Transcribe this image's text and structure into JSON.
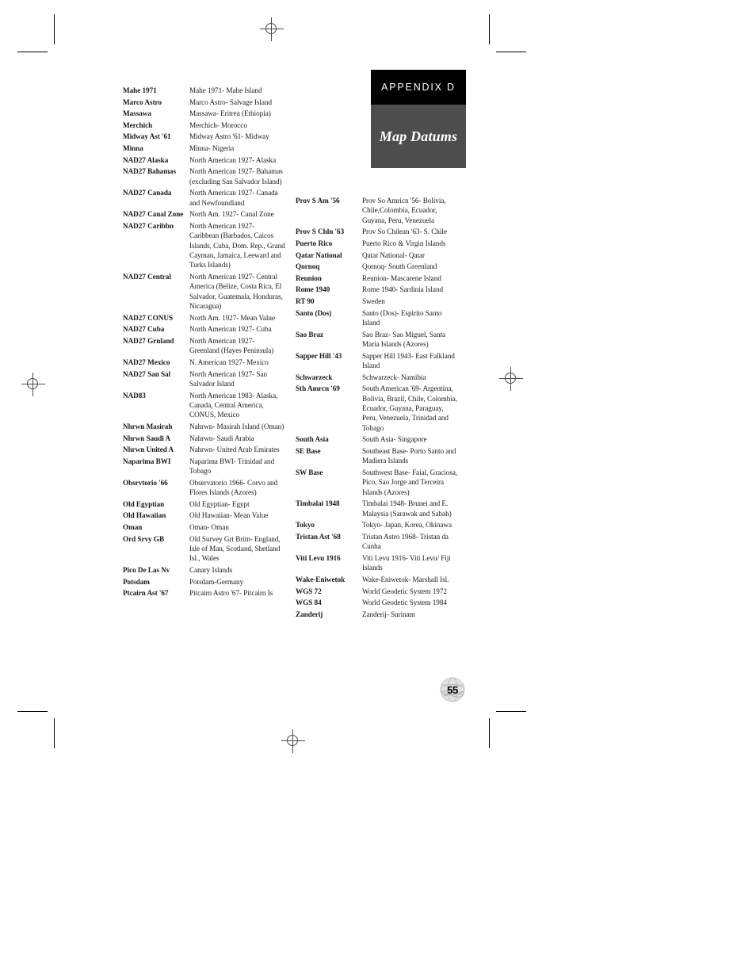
{
  "header": {
    "appendix_label": "APPENDIX D",
    "title": "Map Datums",
    "bar_color": "#000000",
    "title_box_color": "#4d4d4d"
  },
  "page_number": "55",
  "columns": {
    "left": [
      {
        "term": "Mahe 1971",
        "desc": "Mahe 1971- Mahe Island"
      },
      {
        "term": "Marco Astro",
        "desc": "Marco Astro- Salvage Island"
      },
      {
        "term": "Massawa",
        "desc": "Massawa- Eritrea (Ethiopia)"
      },
      {
        "term": "Merchich",
        "desc": "Merchich- Morocco"
      },
      {
        "term": "Midway Ast '61",
        "desc": "Midway Astro '61- Midway"
      },
      {
        "term": "Minna",
        "desc": "Minna- Nigeria"
      },
      {
        "term": "NAD27 Alaska",
        "desc": "North American 1927- Alaska"
      },
      {
        "term": "NAD27 Bahamas",
        "desc": "North American 1927- Bahamas (excluding San Salvador Island)"
      },
      {
        "term": "NAD27 Canada",
        "desc": "North American 1927- Canada and Newfoundland"
      },
      {
        "term": "NAD27 Canal Zone",
        "desc": "North Am. 1927- Canal Zone"
      },
      {
        "term": "NAD27 Caribbn",
        "desc": "North American 1927- Caribbean (Barbados, Caicos Islands, Cuba, Dom. Rep., Grand Cayman, Jamaica, Leeward and Turks Islands)"
      },
      {
        "term": "NAD27 Central",
        "desc": "North American 1927- Central America (Belize, Costa Rica, El Salvador, Guatemala, Honduras, Nicaragua)"
      },
      {
        "term": "NAD27 CONUS",
        "desc": "North Am. 1927- Mean Value"
      },
      {
        "term": "NAD27 Cuba",
        "desc": "North American 1927- Cuba"
      },
      {
        "term": "NAD27 Grnland",
        "desc": "North American 1927- Greenland (Hayes Peninsula)"
      },
      {
        "term": "NAD27 Mexico",
        "desc": "N. American 1927- Mexico"
      },
      {
        "term": "NAD27 San Sal",
        "desc": "North American 1927- San Salvador Island"
      },
      {
        "term": "NAD83",
        "desc": "North American 1983- Alaska, Canada, Central America, CONUS, Mexico"
      },
      {
        "term": "Nhrwn Masirah",
        "desc": "Nahrwn- Masirah Island (Oman)"
      },
      {
        "term": "Nhrwn Saudi A",
        "desc": "Nahrwn- Saudi Arabia"
      },
      {
        "term": "Nhrwn United A",
        "desc": "Nahrwn- United Arab Emirates"
      },
      {
        "term": "Naparima BWI",
        "desc": "Naparima BWI- Trinidad and Tobago"
      },
      {
        "term": "Obsrvtorio '66",
        "desc": "Observatorio 1966- Corvo and Flores Islands (Azores)"
      },
      {
        "term": "Old Egyptian",
        "desc": "Old Egyptian- Egypt"
      },
      {
        "term": "Old Hawaiian",
        "desc": "Old Hawaiian- Mean Value"
      },
      {
        "term": "Oman",
        "desc": "Oman- Oman"
      },
      {
        "term": "Ord Srvy GB",
        "desc": "Old Survey Grt Britn- England, Isle of Man, Scotland, Shetland Isl., Wales"
      },
      {
        "term": "Pico De Las Nv",
        "desc": "Canary Islands"
      },
      {
        "term": "Potsdam",
        "desc": "Potsdam-Germany"
      },
      {
        "term": "Ptcairn Ast '67",
        "desc": "Pitcairn Astro '67- Pitcairn Is"
      }
    ],
    "right": [
      {
        "term": "Prov S Am '56",
        "desc": "Prov So Amricn '56- Bolivia, Chile,Colombia, Ecuador, Guyana, Peru, Venezuela"
      },
      {
        "term": "Prov S Chln '63",
        "desc": "Prov So Chilean '63- S. Chile"
      },
      {
        "term": "Puerto Rico",
        "desc": "Puerto Rico & Virgin Islands"
      },
      {
        "term": "Qatar National",
        "desc": "Qatar National- Qatar"
      },
      {
        "term": "Qornoq",
        "desc": "Qornoq- South Greenland"
      },
      {
        "term": "Reunion",
        "desc": "Reunion- Mascarene Island"
      },
      {
        "term": "Rome 1940",
        "desc": "Rome 1940- Sardinia Island"
      },
      {
        "term": "RT 90",
        "desc": "Sweden"
      },
      {
        "term": "Santo (Dos)",
        "desc": "Santo (Dos)- Espirito Santo Island"
      },
      {
        "term": "Sao Braz",
        "desc": "Sao Braz- Sao Miguel, Santa Maria Islands (Azores)"
      },
      {
        "term": "Sapper Hill '43",
        "desc": "Sapper Hill 1943- East Falkland Island"
      },
      {
        "term": "Schwarzeck",
        "desc": "Schwarzeck- Namibia"
      },
      {
        "term": "Sth Amrcn '69",
        "desc": "South American '69- Argentina, Bolivia, Brazil, Chile, Colombia, Ecuador, Guyana, Paraguay, Peru, Venezuela, Trinidad and Tobago"
      },
      {
        "term": "South Asia",
        "desc": "South Asia- Singapore"
      },
      {
        "term": "SE Base",
        "desc": "Southeast Base- Porto Santo and Madiera Islands"
      },
      {
        "term": "SW Base",
        "desc": "Southwest Base- Faial, Graciosa, Pico, Sao Jorge and Terceira Islands (Azores)"
      },
      {
        "term": "Timbalai 1948",
        "desc": "Timbalai 1948- Brunei and E. Malaysia (Sarawak and Sabah)"
      },
      {
        "term": "Tokyo",
        "desc": "Tokyo- Japan, Korea, Okinawa"
      },
      {
        "term": "Tristan Ast '68",
        "desc": "Tristan Astro 1968- Tristan da Cunha"
      },
      {
        "term": "Viti Levu 1916",
        "desc": "Viti Levu 1916- Viti Levu/ Fiji Islands"
      },
      {
        "term": "Wake-Eniwetok",
        "desc": "Wake-Eniwetok- Marshall Isl."
      },
      {
        "term": "WGS 72",
        "desc": "World Geodetic System 1972"
      },
      {
        "term": "WGS 84",
        "desc": "World Geodetic System 1984"
      },
      {
        "term": "Zanderij",
        "desc": "Zanderij- Surinam"
      }
    ]
  }
}
